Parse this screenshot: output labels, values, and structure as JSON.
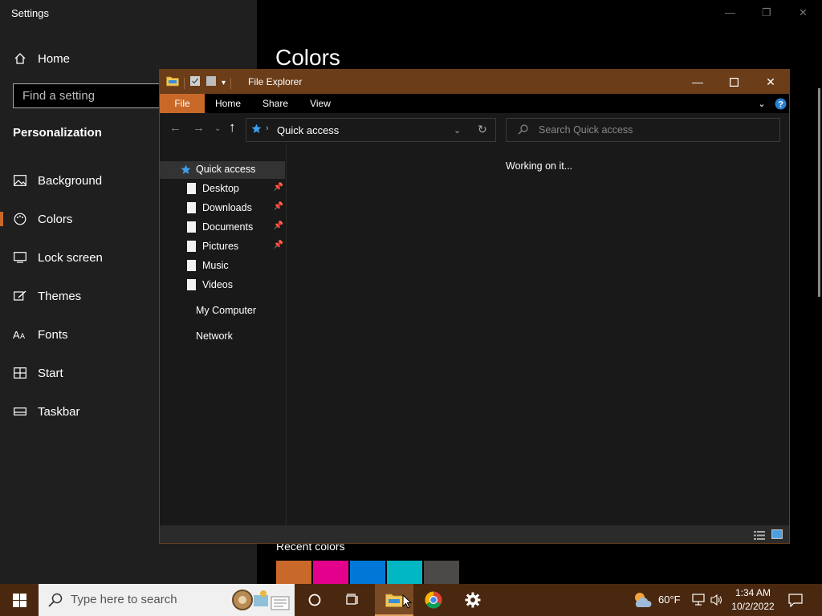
{
  "settings": {
    "title": "Settings",
    "home": "Home",
    "search_placeholder": "Find a setting",
    "section": "Personalization",
    "nav": [
      {
        "label": "Background",
        "icon": "picture-icon"
      },
      {
        "label": "Colors",
        "icon": "palette-icon"
      },
      {
        "label": "Lock screen",
        "icon": "lock-screen-icon"
      },
      {
        "label": "Themes",
        "icon": "brush-icon"
      },
      {
        "label": "Fonts",
        "icon": "fonts-icon"
      },
      {
        "label": "Start",
        "icon": "start-grid-icon"
      },
      {
        "label": "Taskbar",
        "icon": "taskbar-icon"
      }
    ],
    "page_title": "Colors",
    "recent_colors_label": "Recent colors",
    "recent_colors": [
      "#c8692a",
      "#e3008c",
      "#0078d7",
      "#00b7c3",
      "#4c4a48"
    ],
    "accent_color": "#c8692a"
  },
  "explorer": {
    "title": "File Explorer",
    "ribbon_tabs": [
      "File",
      "Home",
      "Share",
      "View"
    ],
    "address": "Quick access",
    "search_placeholder": "Search Quick access",
    "tree": {
      "quick_access": "Quick access",
      "pinned": [
        "Desktop",
        "Downloads",
        "Documents",
        "Pictures"
      ],
      "other": [
        "Music",
        "Videos"
      ],
      "my_computer": "My Computer",
      "network": "Network"
    },
    "status_message": "Working on it...",
    "titlebar_color": "#6b3d18"
  },
  "taskbar": {
    "search_placeholder": "Type here to search",
    "weather": "60°F",
    "time": "1:34 AM",
    "date": "10/2/2022",
    "color": "#4a280f"
  }
}
